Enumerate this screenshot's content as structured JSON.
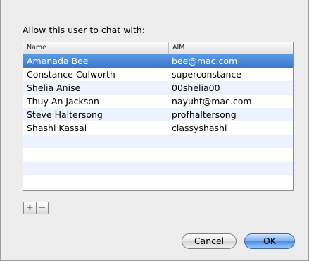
{
  "dialog": {
    "prompt": "Allow this user to chat with:",
    "columns": {
      "name": "Name",
      "aim": "AIM"
    },
    "rows": [
      {
        "name": "Amanada Bee",
        "aim": "bee@mac.com",
        "selected": true
      },
      {
        "name": "Constance Culworth",
        "aim": "superconstance"
      },
      {
        "name": "Shelia Anise",
        "aim": "00shelia00"
      },
      {
        "name": "Thuy-An Jackson",
        "aim": "nayuht@mac.com"
      },
      {
        "name": "Steve Haltersong",
        "aim": "profhaltersong"
      },
      {
        "name": "Shashi Kassai",
        "aim": "classyshashi"
      }
    ],
    "add_label": "+",
    "remove_label": "−",
    "cancel_label": "Cancel",
    "ok_label": "OK"
  },
  "colors": {
    "selection": "#3d7bd3",
    "alt_row": "#edf3fe",
    "default_button": "#5b96e6"
  }
}
